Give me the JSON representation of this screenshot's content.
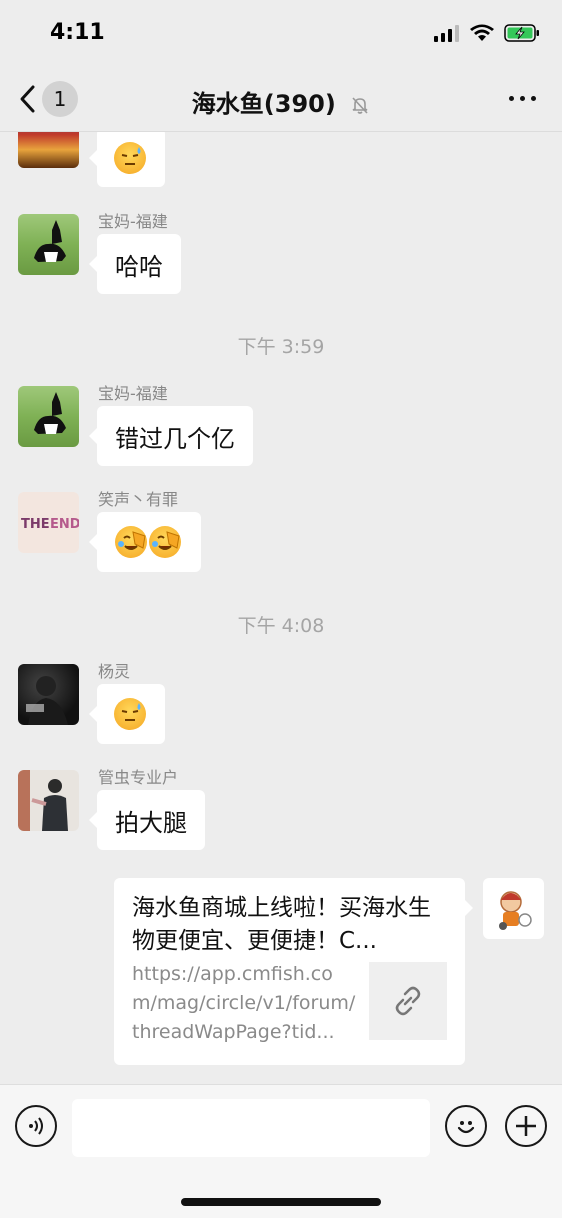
{
  "status_bar": {
    "time": "4:11",
    "icons": [
      "signal-icon",
      "wifi-icon",
      "battery-charging-icon"
    ]
  },
  "nav": {
    "back_icon": "chevron-left-icon",
    "unread_count": "1",
    "title": "海水鱼(390)",
    "mute_icon": "bell-slash-icon",
    "more_icon": "more-dots-icon"
  },
  "messages": [
    {
      "sender": "",
      "content_type": "emoji",
      "emoji": [
        "sweat-smile-emoji"
      ]
    },
    {
      "sender": "宝妈-福建",
      "content_type": "text",
      "text": "哈哈"
    },
    {
      "timestamp": "下午 3:59"
    },
    {
      "sender": "宝妈-福建",
      "content_type": "text",
      "text": "错过几个亿"
    },
    {
      "sender": "笑声丶有罪",
      "content_type": "emoji",
      "emoji": [
        "facepalm-emoji",
        "facepalm-emoji"
      ]
    },
    {
      "timestamp": "下午 4:08"
    },
    {
      "sender": "杨灵",
      "content_type": "emoji",
      "emoji": [
        "sweat-smile-emoji"
      ]
    },
    {
      "sender": "管虫专业户",
      "content_type": "text",
      "text": "拍大腿"
    }
  ],
  "link_message": {
    "title": "海水鱼商城上线啦！买海水生物更便宜、更便捷！C...",
    "url": "https://app.cmfish.com/mag/circle/v1/forum/threadWapPage?tid...",
    "thumb_icon": "link-icon"
  },
  "input_bar": {
    "voice_icon": "voice-icon",
    "placeholder": "",
    "emoji_icon": "smiley-icon",
    "plus_icon": "plus-icon"
  },
  "colors": {
    "background": "#ededed",
    "bubble": "#ffffff",
    "timestamp": "#a5a5a5",
    "sender": "#888888"
  }
}
